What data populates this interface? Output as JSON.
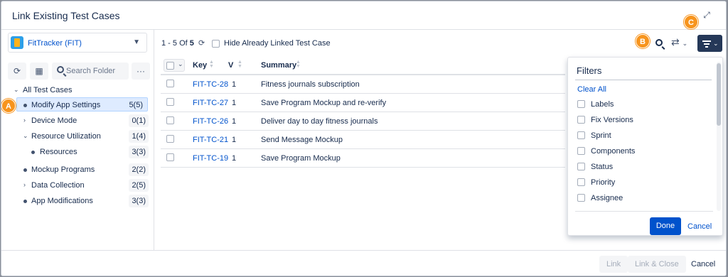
{
  "dialog": {
    "title": "Link Existing Test Cases"
  },
  "badges": {
    "a": "A",
    "b": "B",
    "c": "C"
  },
  "icons": {
    "expand": "expand-icon",
    "refresh": "refresh-icon",
    "calendar": "calendar-sort-icon",
    "more": "more-icon",
    "search": "search-icon",
    "shuffle": "shuffle-icon",
    "filter": "filter-icon"
  },
  "project": {
    "label": "FitTracker (FIT)"
  },
  "search": {
    "placeholder": "Search Folder"
  },
  "tree": {
    "root": "All Test Cases",
    "items": [
      {
        "label": "Modify App Settings",
        "count": "5(5)"
      },
      {
        "label": "Device Mode",
        "count": "0(1)"
      },
      {
        "label": "Resource Utilization",
        "count": "1(4)"
      },
      {
        "label": "Resources",
        "count": "3(3)"
      },
      {
        "label": "Mockup Programs",
        "count": "2(2)"
      },
      {
        "label": "Data Collection",
        "count": "2(5)"
      },
      {
        "label": "App Modifications",
        "count": "3(3)"
      }
    ]
  },
  "pager": {
    "range": "1 - 5",
    "of": "Of",
    "total": "5"
  },
  "hide_linked": {
    "label": "Hide Already Linked Test Case"
  },
  "table": {
    "headers": {
      "key": "Key",
      "version": "V",
      "summary": "Summary"
    },
    "rows": [
      {
        "key": "FIT-TC-28",
        "version": "1",
        "summary": "Fitness journals subscription"
      },
      {
        "key": "FIT-TC-27",
        "version": "1",
        "summary": "Save Program Mockup and re-verify"
      },
      {
        "key": "FIT-TC-26",
        "version": "1",
        "summary": "Deliver day to day fitness journals"
      },
      {
        "key": "FIT-TC-21",
        "version": "1",
        "summary": "Send Message Mockup"
      },
      {
        "key": "FIT-TC-19",
        "version": "1",
        "summary": "Save Program Mockup"
      }
    ]
  },
  "filters": {
    "title": "Filters",
    "clear_all": "Clear All",
    "items": [
      "Labels",
      "Fix Versions",
      "Sprint",
      "Components",
      "Status",
      "Priority",
      "Assignee"
    ],
    "done": "Done",
    "cancel": "Cancel"
  },
  "footer": {
    "link": "Link",
    "link_close": "Link & Close",
    "cancel": "Cancel"
  },
  "colors": {
    "accent": "#0052cc",
    "badge": "#f7941d",
    "filter_button": "#253858",
    "selected_row": "#deebff"
  }
}
